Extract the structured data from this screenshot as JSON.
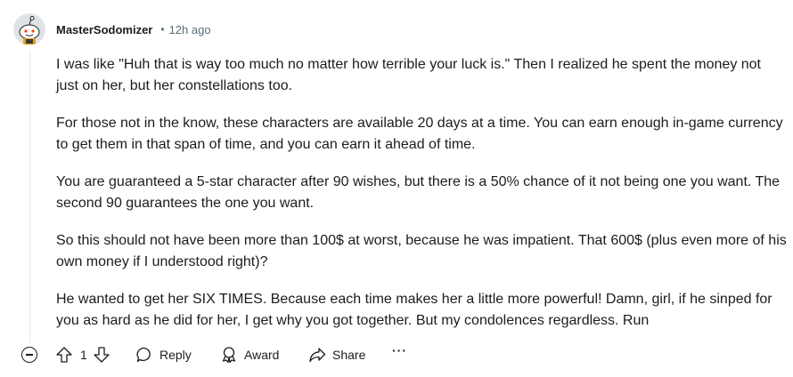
{
  "comment": {
    "author": "MasterSodomizer",
    "separator": "•",
    "time": "12h ago",
    "paragraphs": [
      "I was like \"Huh that is way too much no matter how terrible your luck is.\" Then I realized he spent the money not just on her, but her constellations too.",
      "For those not in the know, these characters are available 20 days at a time. You can earn enough in-game currency to get them in that span of time, and you can earn it ahead of time.",
      "You are guaranteed a 5-star character after 90 wishes, but there is a 50% chance of it not being one you want. The second 90 guarantees the one you want.",
      "So this should not have been more than 100$ at worst, because he was impatient. That 600$ (plus even more of his own money if I understood right)?",
      "He wanted to get her SIX TIMES. Because each time makes her a little more powerful! Damn, girl, if he sinped for you as hard as he did for her, I get why you got together. But my condolences regardless. Run"
    ]
  },
  "actions": {
    "vote_count": "1",
    "reply_label": "Reply",
    "award_label": "Award",
    "share_label": "Share",
    "more_label": "···"
  },
  "icons": {
    "collapse": "collapse-minus-icon",
    "upvote": "upvote-arrow-icon",
    "downvote": "downvote-arrow-icon",
    "reply": "speech-bubble-icon",
    "award": "award-ribbon-icon",
    "share": "share-arrow-icon"
  },
  "colors": {
    "text": "#1c1c1c",
    "meta": "#576f76",
    "thread_line": "#e5e7ea"
  }
}
